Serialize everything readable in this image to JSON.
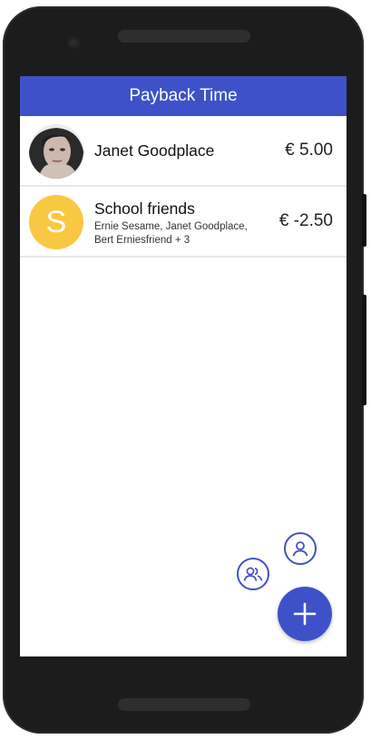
{
  "app": {
    "title": "Payback Time",
    "accent_color": "#3f51c9"
  },
  "list": [
    {
      "name": "Janet Goodplace",
      "amount": "€ 5.00",
      "avatar": "photo"
    },
    {
      "name": "School friends",
      "avatar_letter": "S",
      "avatar_color": "#f9c842",
      "members": "Ernie Sesame, Janet Goodplace, Bert Erniesfriend + 3",
      "amount": "€ -2.50"
    }
  ],
  "fab": {
    "main_icon": "plus-icon",
    "actions": [
      "person-icon",
      "group-icon"
    ]
  }
}
